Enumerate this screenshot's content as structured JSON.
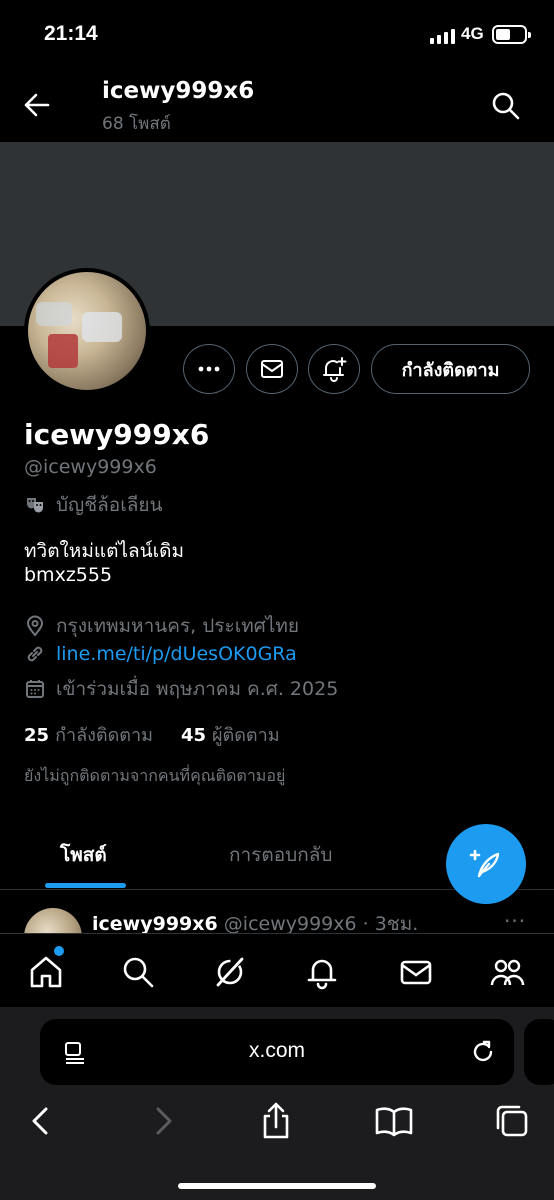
{
  "status_bar": {
    "time": "21:14",
    "network": "4G",
    "battery_level": 0.5
  },
  "header": {
    "title": "icewy999x6",
    "post_count": "68 โพสต์"
  },
  "profile": {
    "display_name": "icewy999x6",
    "handle": "@icewy999x6",
    "parody_label": "บัญชีล้อเลียน",
    "bio_line1": "ทวิตใหม่แต่ไลน์เดิม",
    "bio_line2": "bmxz555",
    "location": "กรุงเทพมหานคร, ประเทศไทย",
    "link": "line.me/ti/p/dUesOK0GRa",
    "joined": "เข้าร่วมเมื่อ พฤษภาคม ค.ศ. 2025",
    "following_count": "25",
    "following_label": "กำลังติดตาม",
    "followers_count": "45",
    "followers_label": "ผู้ติดตาม",
    "not_followed_note": "ยังไม่ถูกติดตามจากคนที่คุณติดตามอยู่"
  },
  "actions": {
    "follow_state_label": "กำลังติดตาม"
  },
  "tabs": [
    {
      "label": "โพสต์",
      "active": true
    },
    {
      "label": "การตอบกลับ",
      "active": false
    }
  ],
  "tweet_preview": {
    "name": "icewy999x6",
    "handle_time": "@icewy999x6 · 3ชม.",
    "more": "···"
  },
  "browser": {
    "url": "x.com"
  },
  "colors": {
    "accent": "#1d9bf0",
    "banner": "#2f3336",
    "muted": "#71767b"
  }
}
